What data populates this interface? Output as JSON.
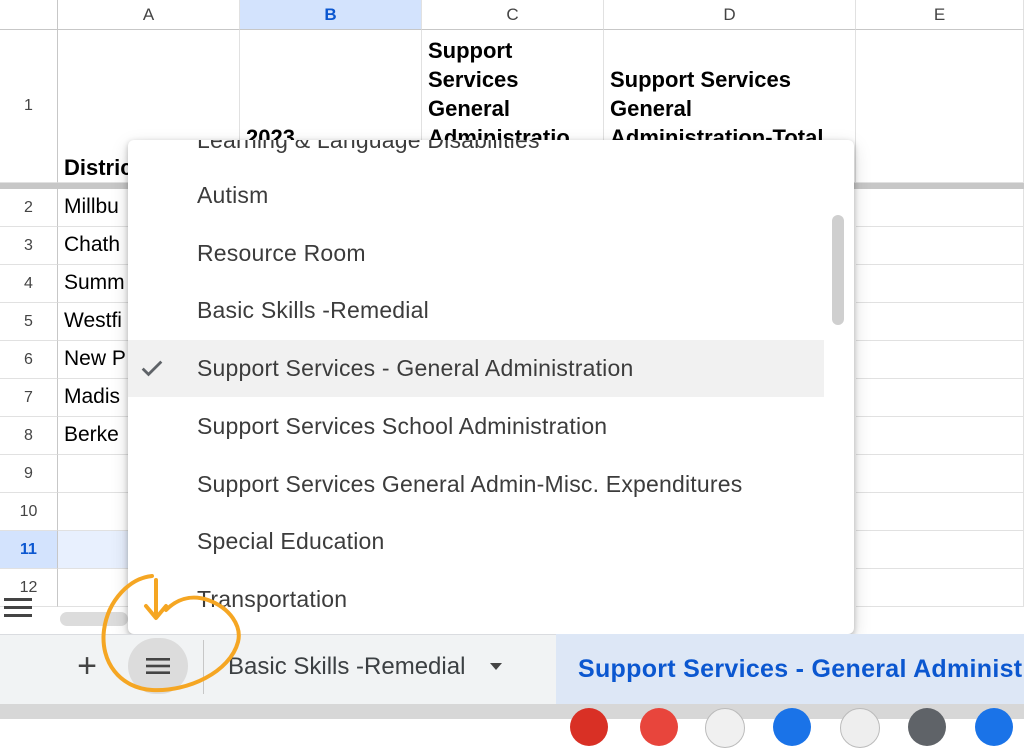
{
  "columns": [
    "A",
    "B",
    "C",
    "D",
    "E"
  ],
  "rows": [
    "1",
    "2",
    "3",
    "4",
    "5",
    "6",
    "7",
    "8",
    "9",
    "10",
    "11",
    "12"
  ],
  "header_cells": {
    "a1": "District",
    "b1": "2023",
    "c1": "Support Services General Administratio",
    "d1": "Support Services General Administration-Total"
  },
  "column_a_values": [
    "Millbu",
    "Chath",
    "Summ",
    "Westfi",
    "New P",
    "Madis",
    "Berke"
  ],
  "dropdown": {
    "partial_top_item": "Learning & Language Disabilities",
    "items": [
      {
        "label": "Autism",
        "checked": false
      },
      {
        "label": "Resource Room",
        "checked": false
      },
      {
        "label": "Basic Skills -Remedial",
        "checked": false
      },
      {
        "label": "Support Services - General Administration",
        "checked": true
      },
      {
        "label": "Support Services School Administration",
        "checked": false
      },
      {
        "label": "Support Services General Admin-Misc. Expenditures",
        "checked": false
      },
      {
        "label": "Special Education",
        "checked": false
      },
      {
        "label": "Transportation",
        "checked": false
      }
    ]
  },
  "tabbar": {
    "add_label": "+",
    "sheet_tabs": [
      {
        "label": "Basic Skills -Remedial",
        "active": false
      },
      {
        "label": "Support Services - General Administration",
        "active": true
      }
    ]
  },
  "colors": {
    "accent": "#0b57d0",
    "selected_header_bg": "#d3e3fd",
    "annotation": "#f5a623"
  }
}
